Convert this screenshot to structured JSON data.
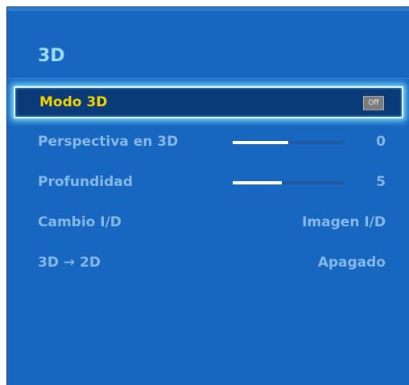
{
  "menu": {
    "title": "3D",
    "items": [
      {
        "label": "Modo 3D",
        "value": "Off",
        "kind": "toggle",
        "selected": true
      },
      {
        "label": "Perspectiva en 3D",
        "value": "0",
        "kind": "slider",
        "level": 0.5
      },
      {
        "label": "Profundidad",
        "value": "5",
        "kind": "slider",
        "level": 0.44
      },
      {
        "label": "Cambio I/D",
        "value": "Imagen I/D",
        "kind": "text"
      },
      {
        "label": "3D → 2D",
        "value": "Apagado",
        "kind": "text"
      }
    ]
  },
  "colors": {
    "panel_bg": "#1766c0",
    "title": "#9fdcff",
    "selected_label": "#f5d300",
    "selected_bg": "#0b3a78",
    "inactive_text": "#86b8e8"
  }
}
